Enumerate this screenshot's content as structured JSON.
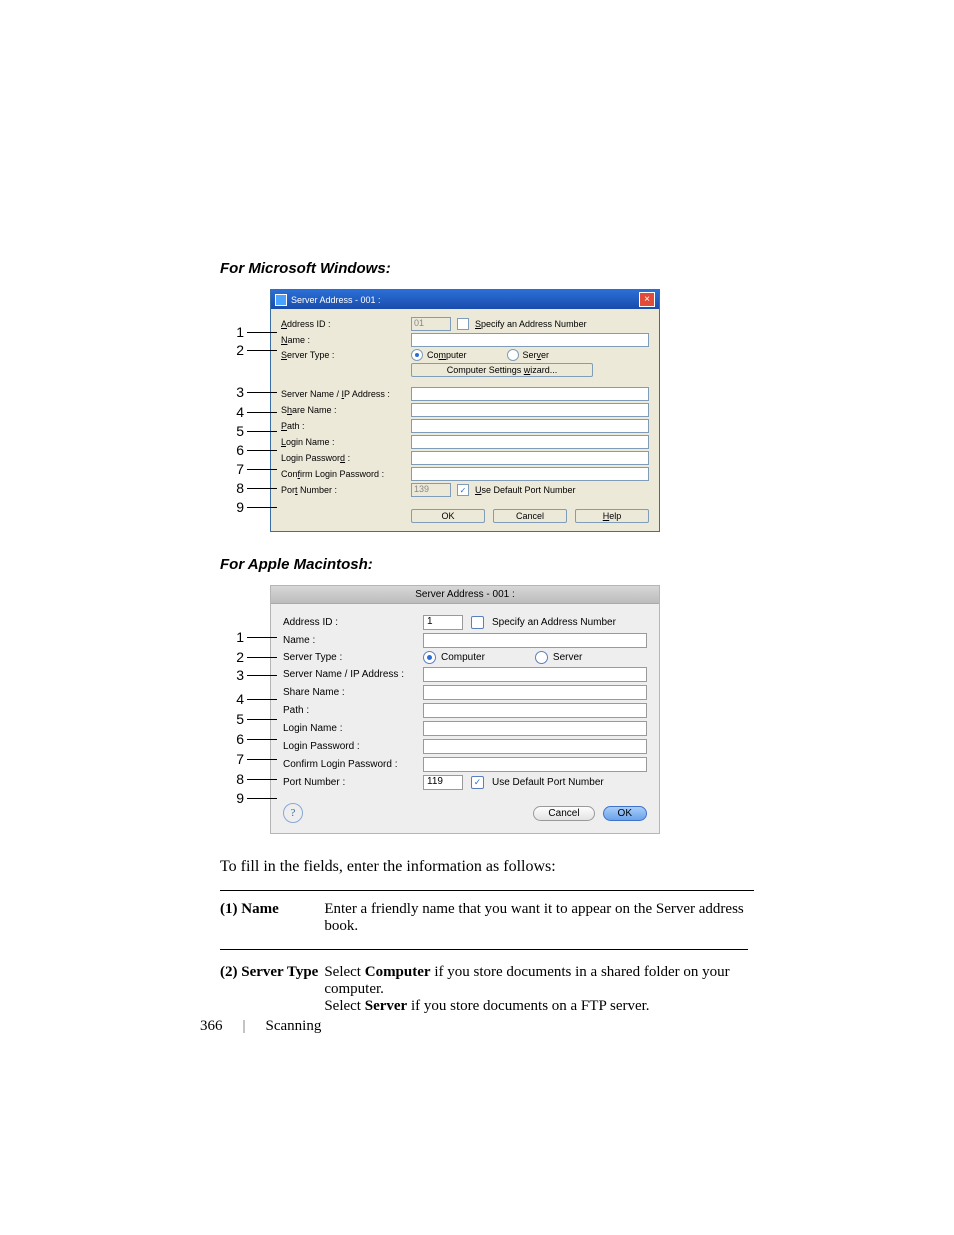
{
  "headings": {
    "windows": "For Microsoft Windows:",
    "mac": "For Apple Macintosh:"
  },
  "callouts": [
    "1",
    "2",
    "3",
    "4",
    "5",
    "6",
    "7",
    "8",
    "9"
  ],
  "windows": {
    "title": "Server Address - 001 :",
    "labels": {
      "addressId": "Address ID :",
      "name": "Name :",
      "serverType": "Server Type :",
      "serverNameIp": "Server Name / IP Address :",
      "shareName": "Share Name :",
      "path": "Path :",
      "loginName": "Login Name :",
      "loginPassword": "Login Password :",
      "confirmLoginPassword": "Confirm Login Password :",
      "portNumber": "Port Number :"
    },
    "underlineChars": {
      "addressId": "A",
      "name": "N",
      "serverType": "S",
      "specify": "S",
      "computer": "m",
      "server": "v",
      "wizard": "w",
      "ip": "I",
      "share": "h",
      "path": "P",
      "loginName": "L",
      "loginPwd": "d",
      "confirm": "f",
      "port": "t",
      "useDefault": "U",
      "help": "H"
    },
    "values": {
      "addressId": "01",
      "portNumber": "139"
    },
    "checks": {
      "specify": "Specify an Address Number",
      "useDefault": "Use Default Port Number"
    },
    "radios": {
      "computer": "Computer",
      "server": "Server"
    },
    "buttons": {
      "wizard": "Computer Settings wizard...",
      "ok": "OK",
      "cancel": "Cancel",
      "help": "Help"
    }
  },
  "mac": {
    "title": "Server Address - 001 :",
    "labels": {
      "addressId": "Address ID :",
      "name": "Name :",
      "serverType": "Server Type :",
      "serverNameIp": "Server Name / IP Address :",
      "shareName": "Share Name :",
      "path": "Path :",
      "loginName": "Login Name :",
      "loginPassword": "Login Password :",
      "confirmLoginPassword": "Confirm Login Password :",
      "portNumber": "Port Number :"
    },
    "values": {
      "addressId": "1",
      "portNumber": "119"
    },
    "checks": {
      "specify": "Specify an Address Number",
      "useDefault": "Use Default Port Number"
    },
    "radios": {
      "computer": "Computer",
      "server": "Server"
    },
    "buttons": {
      "cancel": "Cancel",
      "ok": "OK",
      "help": "?"
    }
  },
  "instruction": "To fill in the fields, enter the information as follows:",
  "table": {
    "row1": {
      "key": "(1) Name",
      "val": "Enter a friendly name that you want it to appear on the Server address book."
    },
    "row2": {
      "key": "(2) Server Type",
      "val_pre": "Select ",
      "val_bold1": "Computer",
      "val_mid1": " if you store documents in a shared folder on your computer.",
      "val_nl": "Select ",
      "val_bold2": "Server",
      "val_mid2": " if you store documents on a FTP server."
    }
  },
  "footer": {
    "page": "366",
    "section": "Scanning"
  }
}
